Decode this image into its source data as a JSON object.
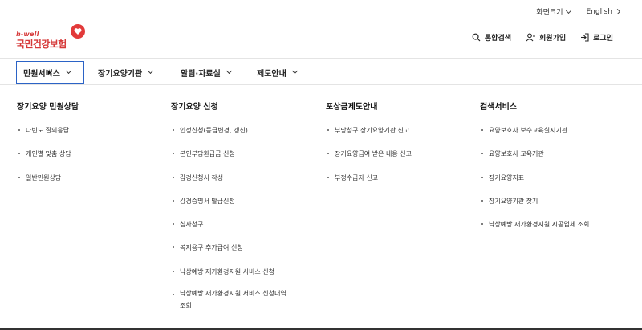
{
  "utility": {
    "font_size_label": "화면크기",
    "language_label": "English"
  },
  "logo": {
    "en": "h-well",
    "ko": "국민건강보험"
  },
  "actions": {
    "search": "통합검색",
    "join": "회원가입",
    "login": "로그인"
  },
  "nav": {
    "items": [
      {
        "label": "민원서비스"
      },
      {
        "label": "장기요양기관"
      },
      {
        "label": "알림·자료실"
      },
      {
        "label": "제도안내"
      }
    ]
  },
  "menu": {
    "columns": [
      {
        "title": "장기요양 민원상담",
        "items": [
          "다빈도 질의응답",
          "개인별 맞춤 상담",
          "일반민원상담"
        ]
      },
      {
        "title": "장기요양 신청",
        "items": [
          "인정신청(등급변경, 갱신)",
          "본인부담환급금 신청",
          "감경신청서 작성",
          "감경증명서 발급신청",
          "심사청구",
          "복지용구 추가급여 신청",
          "낙상예방 재가환경지원 서비스 신청",
          "낙상예방 재가환경지원 서비스 신청내역",
          "조회"
        ]
      },
      {
        "title": "포상금제도안내",
        "items": [
          "부당청구 장기요양기관 신고",
          "장기요양급여 받은 내용 신고",
          "부정수급자 신고"
        ]
      },
      {
        "title": "검색서비스",
        "items": [
          "요양보호사 보수교육실시기관",
          "요양보호사 교육기관",
          "장기요양지표",
          "장기요양기관 찾기",
          "낙상예방 재가환경지원 시공업체 조회"
        ]
      }
    ]
  },
  "colors": {
    "brand": "#d63a3a",
    "active_border": "#2b63c6"
  }
}
